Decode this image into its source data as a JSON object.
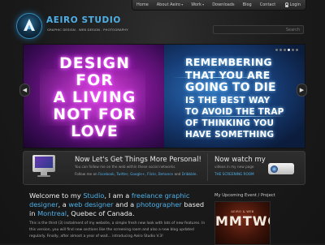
{
  "nav": {
    "items": [
      "Home",
      "About Aeiro",
      "Work",
      "Downloads",
      "Blog",
      "Contact"
    ],
    "login": "Login"
  },
  "logo": {
    "title": "AEIRO STUDIO",
    "subtitle": "GRAPHIC DESIGN . WEB DESIGN . PHOTOGRAPHY"
  },
  "search": {
    "placeholder": "Search"
  },
  "slider": {
    "left_lines": [
      "DESIGN",
      "FOR",
      "A LIVING",
      "NOT FOR",
      "LOVE"
    ],
    "right_lines": [
      "REMEMBERING",
      "THAT YOU ARE",
      "GOING TO DIE",
      "IS THE BEST WAY",
      "TO AVOID THE TRAP",
      "OF THINKING YOU",
      "HAVE SOMETHING"
    ],
    "slide_count": 6,
    "active_slide": 3
  },
  "promo": {
    "title": "Now Let's Get Things More Personal!",
    "subtitle": "You can follow me on the web within these social networks.",
    "follow_prefix": "Follow me on",
    "links": [
      "Facebook",
      "Twitter",
      "Google+",
      "Flickr",
      "Behance",
      "Dribbble"
    ],
    "watch_title": "Now watch my",
    "watch_subtitle": "videos in my new page",
    "watch_link": "THE SCREENING ROOM"
  },
  "welcome": {
    "t1": "Welcome to my ",
    "studio": "Studio",
    "t2": ", I am a ",
    "role1": "freelance graphic designer",
    "t3": ", a ",
    "role2": "web designer",
    "t4": " and a ",
    "role3": "photographer",
    "t5": " based in ",
    "city": "Montreal",
    "t6": ", Quebec of Canada.",
    "body": "This is the third (3) instalment of my website, a simple fresh new look with lots of new features. In this version, you will find new sections like the screening room and also a new blog updated regularly. Finally, after almost a year of wait... introducing Aeiro Studio V.3!"
  },
  "event": {
    "title": "My Upcoming Event / Project",
    "poster_small": "AEIRO & WEB",
    "poster_big": "MMTWO"
  }
}
